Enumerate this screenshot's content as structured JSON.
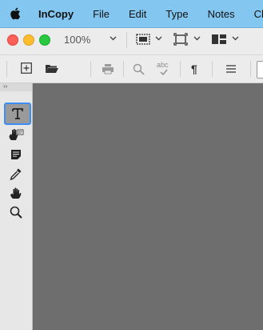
{
  "menubar": {
    "app_name": "InCopy",
    "items": [
      "File",
      "Edit",
      "Type",
      "Notes",
      "Ch"
    ]
  },
  "window": {
    "zoom_level": "100%"
  },
  "toolbar": {
    "icons": [
      "add-icon",
      "open-folder-icon",
      "print-icon",
      "find-icon",
      "spellcheck-icon",
      "pilcrow-icon",
      "menu-icon"
    ],
    "spellcheck_text": "abc",
    "pilcrow_text": "¶"
  },
  "tools": {
    "panel_collapse_label": "››",
    "items": [
      "type-tool",
      "note-tool",
      "position-tool",
      "eyedropper-tool",
      "hand-tool",
      "zoom-tool"
    ],
    "selected": "type-tool"
  },
  "colors": {
    "menubar_bg": "#83c6f0",
    "selection_border": "#3a8ef6",
    "canvas_bg": "#6e6e6e"
  }
}
